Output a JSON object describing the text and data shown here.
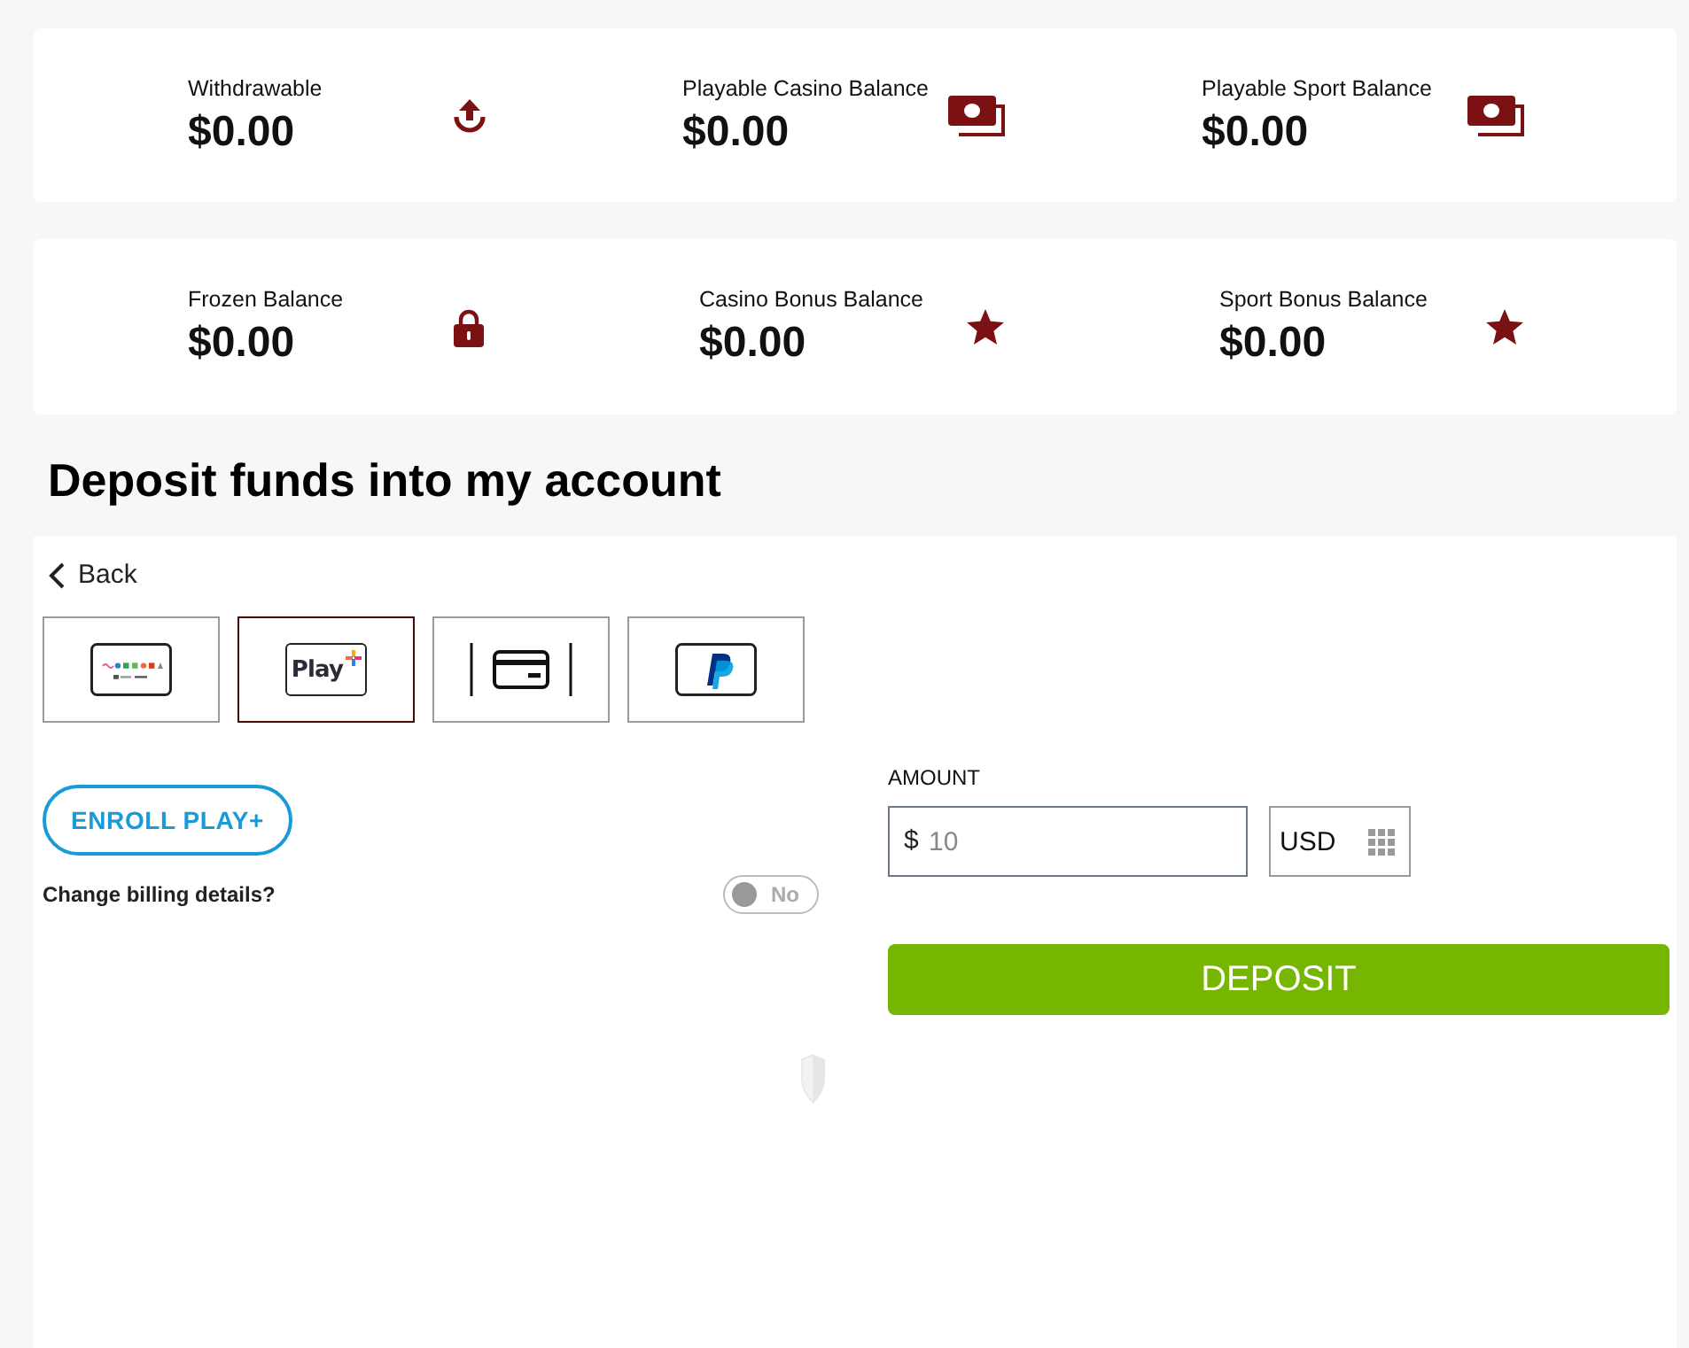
{
  "balance_panels": [
    {
      "items": [
        {
          "kind": "withdrawable",
          "label": "Withdrawable",
          "value": "$0.00"
        },
        {
          "kind": "playable",
          "label": "Playable Casino Balance",
          "value": "$0.00"
        },
        {
          "kind": "playable",
          "label": "Playable Sport Balance",
          "value": "$0.00"
        }
      ]
    },
    {
      "items": [
        {
          "kind": "frozen",
          "label": "Frozen Balance",
          "value": "$0.00"
        },
        {
          "kind": "bonus",
          "label": "Casino Bonus Balance",
          "value": "$0.00"
        },
        {
          "kind": "bonus",
          "label": "Sport Bonus Balance",
          "value": "$0.00"
        }
      ]
    }
  ],
  "heading": "Deposit funds into my account",
  "deposit": {
    "back_link": "Back",
    "payment_methods": [
      {
        "kind": "banks",
        "selected": false
      },
      {
        "kind": "playplus",
        "logo_text": "Play",
        "selected": true
      },
      {
        "kind": "card",
        "selected": false
      },
      {
        "kind": "paypal",
        "selected": false
      }
    ],
    "enroll_button": "ENROLL PLAY+",
    "billing_toggle": {
      "label": "Change billing details?",
      "on": false,
      "state_text": "No"
    },
    "amount": {
      "label": "AMOUNT",
      "prefix": "$",
      "placeholder": "10",
      "currency": "USD"
    },
    "deposit_button": "DEPOSIT"
  }
}
